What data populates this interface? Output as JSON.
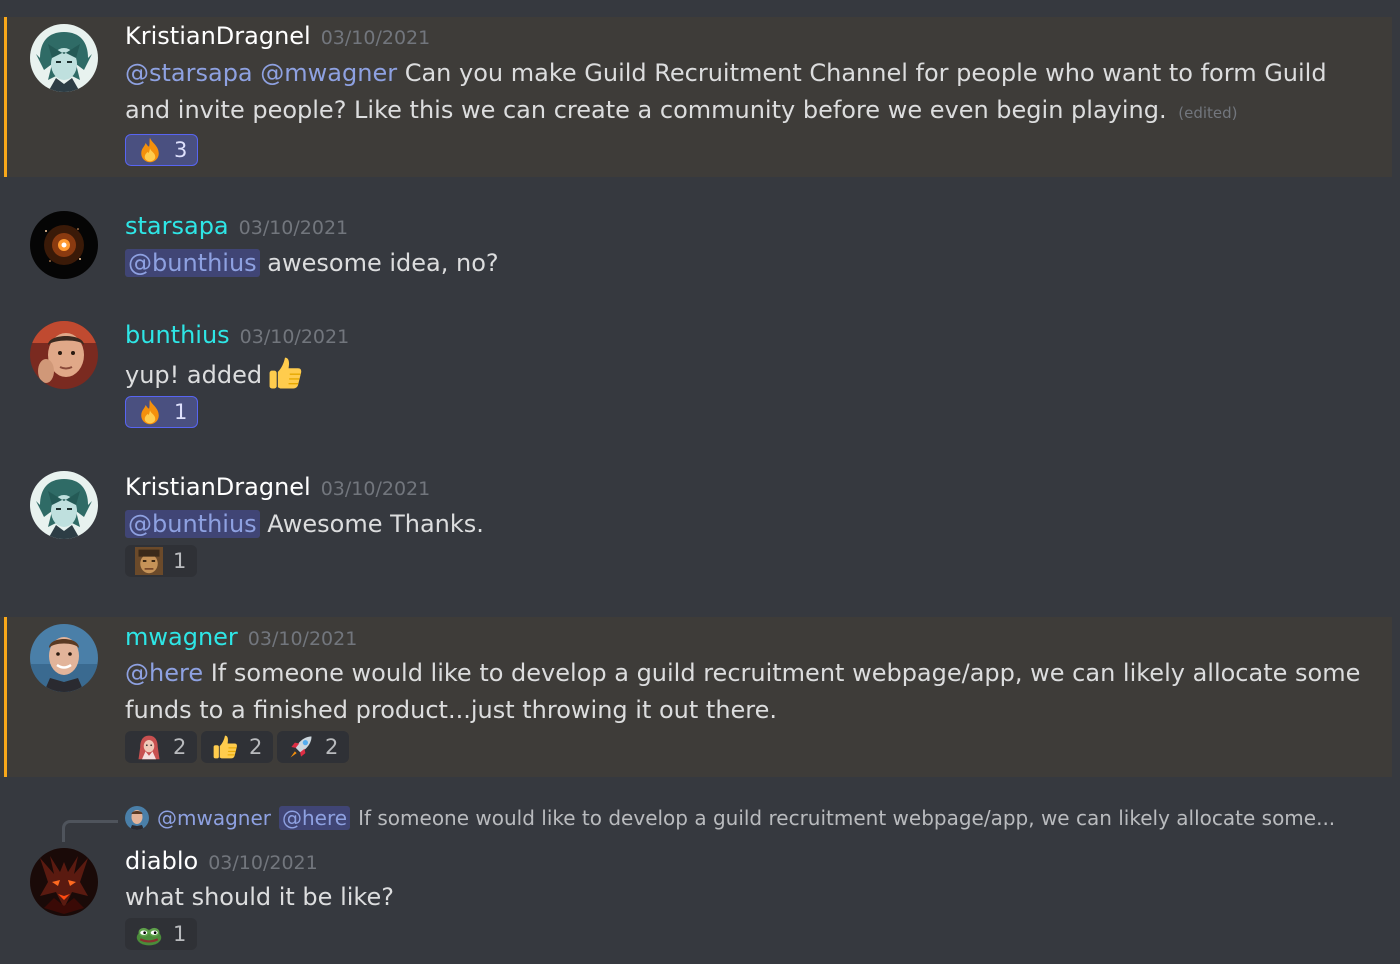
{
  "messages": [
    {
      "author": "KristianDragnel",
      "timestamp": "03/10/2021",
      "mention1": "@starsapa",
      "mention2": "@mwagner",
      "text": " Can you make Guild Recruitment Channel for people who want to form Guild and invite people? Like this we can create a community before we even begin playing.",
      "edited": "(edited)",
      "reactions": [
        {
          "emoji": "fire",
          "count": "3"
        }
      ]
    },
    {
      "author": "starsapa",
      "timestamp": "03/10/2021",
      "mention": "@bunthius",
      "text": " awesome idea, no?"
    },
    {
      "author": "bunthius",
      "timestamp": "03/10/2021",
      "text": "yup! added",
      "inline_emoji": "thumbs-up",
      "reactions": [
        {
          "emoji": "fire",
          "count": "1"
        }
      ]
    },
    {
      "author": "KristianDragnel",
      "timestamp": "03/10/2021",
      "mention": "@bunthius",
      "text": " Awesome Thanks.",
      "reactions": [
        {
          "emoji": "custom-face",
          "count": "1"
        }
      ]
    },
    {
      "author": "mwagner",
      "timestamp": "03/10/2021",
      "mention": "@here",
      "text": " If someone would like to develop a guild recruitment webpage/app, we can likely allocate some funds to a finished product...just throwing it out there.",
      "reactions": [
        {
          "emoji": "custom-character",
          "count": "2"
        },
        {
          "emoji": "thumbs-up",
          "count": "2"
        },
        {
          "emoji": "rocket",
          "count": "2"
        }
      ]
    },
    {
      "reply": {
        "author": "@mwagner",
        "mention": "@here",
        "text": "If someone would like to develop a guild recruitment webpage/app, we can likely allocate some..."
      },
      "author": "diablo",
      "timestamp": "03/10/2021",
      "text": "what should it be like?",
      "reactions": [
        {
          "emoji": "pepe-frog",
          "count": "1"
        }
      ]
    }
  ],
  "colors": {
    "background": "#36393f",
    "highlight": "#3e3c39",
    "highlight_bar": "#faa81a",
    "mention": "#8ea1e1",
    "username_cyan": "#2ee6e6",
    "timestamp": "#72767d"
  }
}
